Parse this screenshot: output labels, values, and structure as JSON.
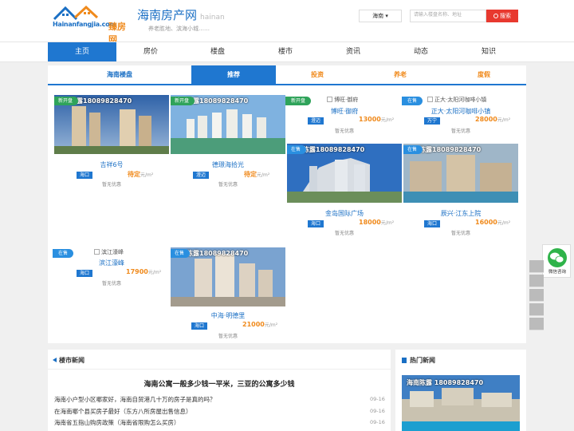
{
  "header": {
    "logo_text": "Hainanfangjia.com",
    "logo_sub": "臻房网",
    "site_title": "海南房产网",
    "site_pinyin": "hainan",
    "slogan": "养老胜地、滨海小城……",
    "city": "海南",
    "search_placeholder": "请输入楼盘名称、地址",
    "search_label": "搜索"
  },
  "nav": [
    "主页",
    "房价",
    "楼盘",
    "楼市",
    "资讯",
    "动态",
    "知识"
  ],
  "tabs": {
    "title": "海南楼盘",
    "items": [
      "推荐",
      "投资",
      "养老",
      "度假"
    ]
  },
  "watermark": "陈露18089828470",
  "promo": "暂无优惠",
  "listings": [
    {
      "badge": "新开盘",
      "name": "吉祥6号",
      "region": "海口",
      "price": "待定",
      "unit": "元/m²"
    },
    {
      "badge": "新开盘",
      "name": "德璟海拾光",
      "region": "澄迈",
      "price": "待定",
      "unit": "元/m²"
    },
    {
      "badge": "新开盘",
      "name": "博旺·御府",
      "alt": "博旺·御府",
      "region": "澄迈",
      "price": "13000",
      "unit": "元/m²"
    },
    {
      "badge": "在售",
      "name": "正大·太阳河咖啡小镇",
      "alt": "正大·太阳河咖啡小镇",
      "region": "万宁",
      "price": "28000",
      "unit": "元/m²"
    },
    {
      "badge": "在售",
      "name": "金岛国际广场",
      "region": "海口",
      "price": "18000",
      "unit": "元/m²"
    },
    {
      "badge": "在售",
      "name": "辰兴·江东上院",
      "region": "海口",
      "price": "16000",
      "unit": "元/m²"
    },
    {
      "badge": "在售",
      "name": "滨江濠峰",
      "alt": "滨江濠峰",
      "region": "海口",
      "price": "17900",
      "unit": "元/m²"
    },
    {
      "badge": "在售",
      "name": "中海·明德里",
      "region": "海口",
      "price": "21000",
      "unit": "元/m²"
    }
  ],
  "news": {
    "title": "楼市新闻",
    "headline": "海南公寓一般多少钱一平米，三亚的公寓多少钱",
    "items": [
      {
        "text": "海南小户型小区哪家好，海南自贸港几十万的房子是真的吗？",
        "date": "09-16"
      },
      {
        "text": "在海南哪个县买房子最好（东方八所房屋出售信息）",
        "date": "09-16"
      },
      {
        "text": "海南省五指山购房政策（海南省限购怎么买房）",
        "date": "09-16"
      }
    ]
  },
  "hot": {
    "title": "热门新闻",
    "watermark": "海南陈露 18089828470"
  },
  "side": {
    "wechat_label": "微信咨询"
  },
  "colors": {
    "brand_blue": "#1f77d0",
    "accent_orange": "#f08a1c",
    "search_red": "#e8392f",
    "badge_green": "#2fa35a"
  }
}
